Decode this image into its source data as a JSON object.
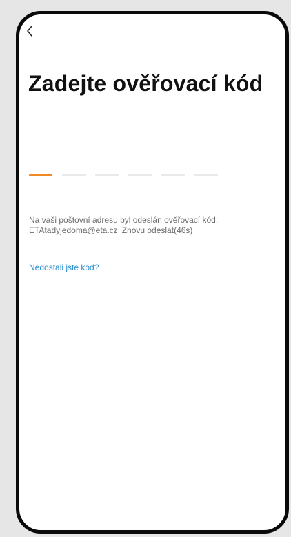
{
  "screen": {
    "title": "Zadejte ověřovací kód",
    "code_length": 6,
    "active_slot": 0,
    "colors": {
      "active_slot": "#f08a24",
      "inactive_slot": "#e9e9e9",
      "link": "#2a8fd0"
    },
    "info_line1": "Na vaši poštovní adresu byl odeslán ověřovací kód:",
    "email": "ETAtadyjedoma@eta.cz",
    "resend_label": "Znovu odeslat(46s)",
    "no_code_link": "Nedostali jste kód?"
  },
  "icons": {
    "back": "chevron-left-icon"
  }
}
